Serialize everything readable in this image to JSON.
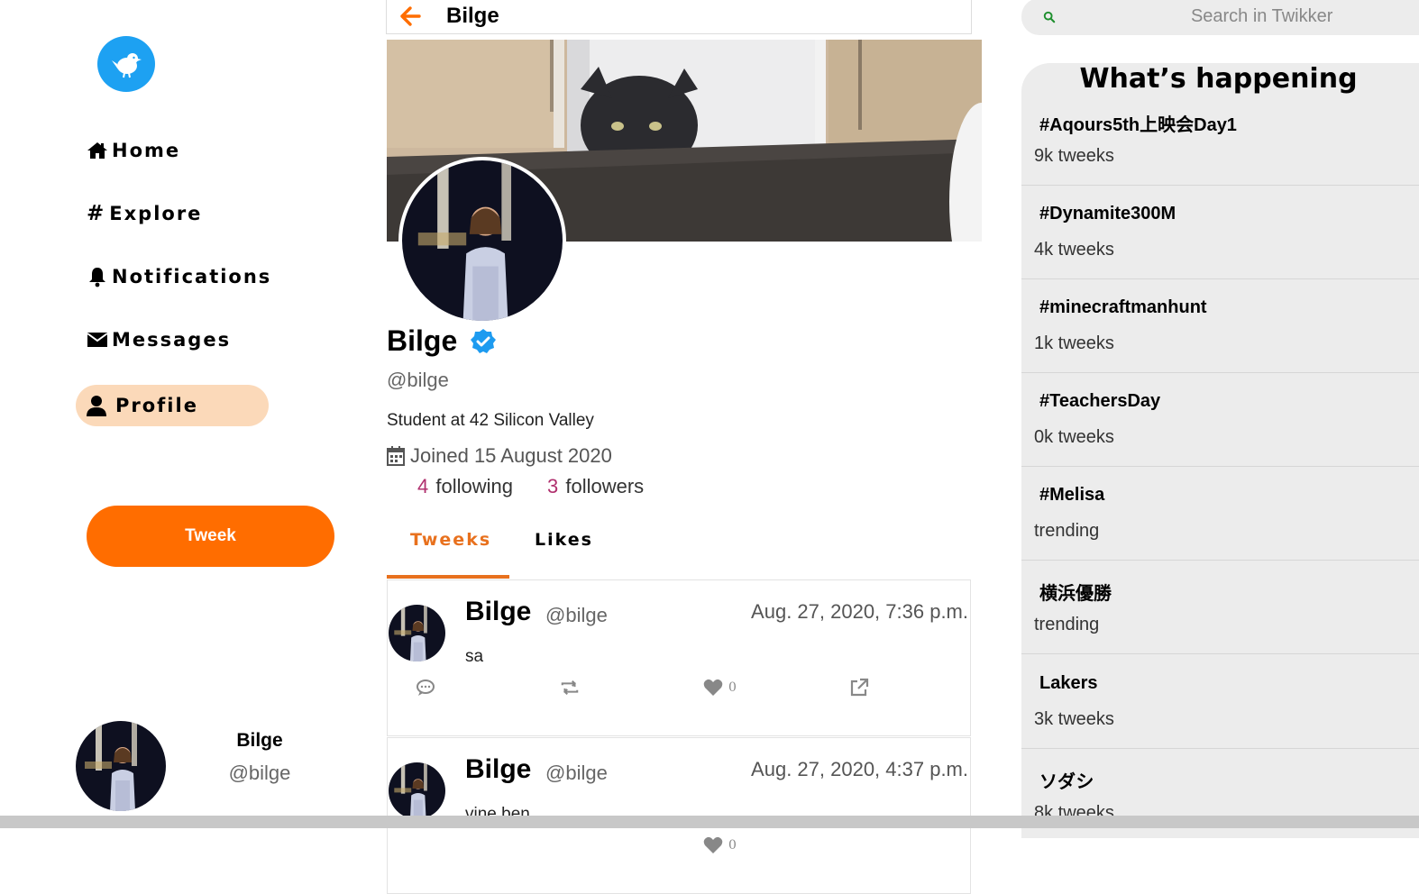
{
  "sidebar": {
    "nav": [
      {
        "label": "Home",
        "icon": "home-icon"
      },
      {
        "label": "Explore",
        "icon": "hash-icon"
      },
      {
        "label": "Notifications",
        "icon": "bell-icon"
      },
      {
        "label": "Messages",
        "icon": "envelope-icon"
      }
    ],
    "profile_label": "Profile",
    "tweek_button": "Tweek",
    "account": {
      "name": "Bilge",
      "handle": "@bilge"
    }
  },
  "header": {
    "title": "Bilge"
  },
  "profile": {
    "name": "Bilge",
    "handle": "@bilge",
    "bio": "Student at 42 Silicon Valley",
    "joined": "Joined 15 August 2020",
    "following_count": "4",
    "following_label": "following",
    "followers_count": "3",
    "followers_label": "followers"
  },
  "tabs": [
    {
      "label": "Tweeks",
      "active": true
    },
    {
      "label": "Likes",
      "active": false
    }
  ],
  "tweets": [
    {
      "name": "Bilge",
      "handle": "@bilge",
      "date": "Aug. 27, 2020, 7:36 p.m.",
      "text": "sa",
      "likes": "0"
    },
    {
      "name": "Bilge",
      "handle": "@bilge",
      "date": "Aug. 27, 2020, 4:37 p.m.",
      "text": "vine ben",
      "likes": "0"
    }
  ],
  "search": {
    "placeholder": "Search in Twikker"
  },
  "trends": {
    "title": "What’s happening",
    "items": [
      {
        "name": "#Aqours5th上映会Day1",
        "count": "9k tweeks"
      },
      {
        "name": "#Dynamite300M",
        "count": "4k tweeks"
      },
      {
        "name": "#minecraftmanhunt",
        "count": "1k tweeks"
      },
      {
        "name": "#TeachersDay",
        "count": "0k tweeks"
      },
      {
        "name": "#Melisa",
        "count": "trending"
      },
      {
        "name": "横浜優勝",
        "count": "trending"
      },
      {
        "name": "Lakers",
        "count": "3k tweeks"
      },
      {
        "name": "ソダシ",
        "count": "8k tweeks"
      }
    ]
  },
  "colors": {
    "accent": "#ff6d00",
    "tab_accent": "#e8711e",
    "brand_blue": "#1da1f2",
    "count_color": "#b0306e",
    "profile_pill": "#fbd9b9"
  }
}
